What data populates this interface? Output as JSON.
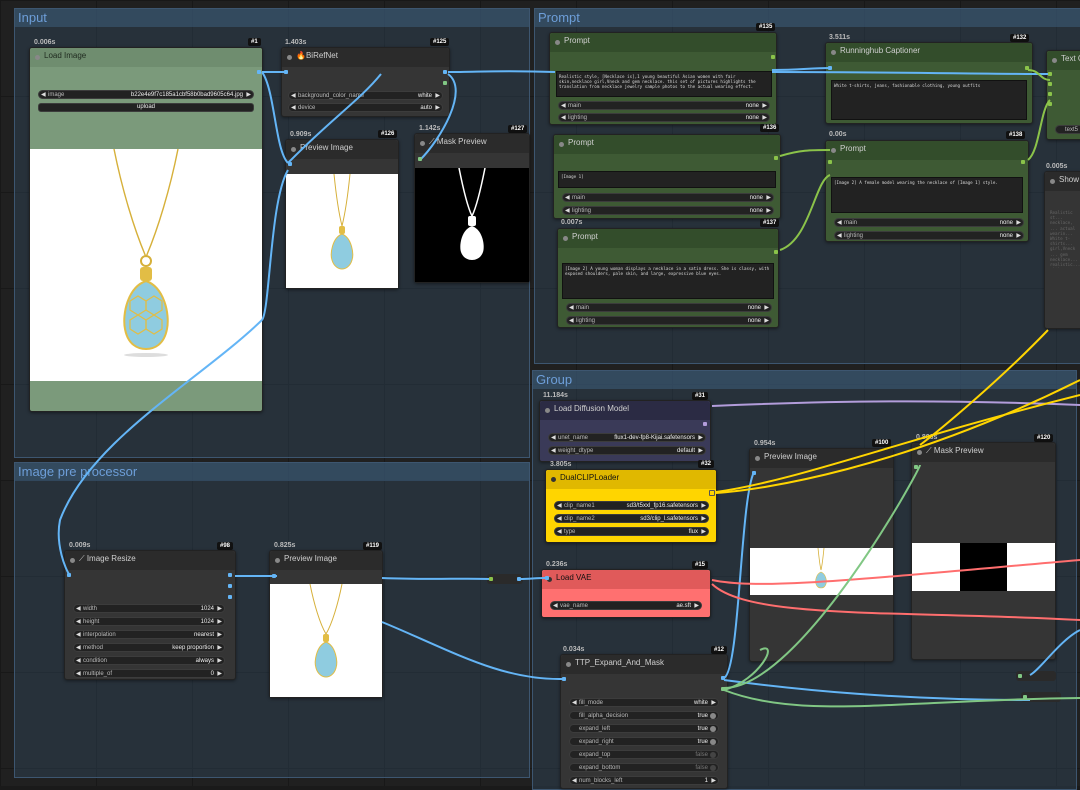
{
  "groups": {
    "input": "Input",
    "prompt": "Prompt",
    "preproc": "Image pre processor",
    "group": "Group"
  },
  "nodes": {
    "load_image": {
      "time": "0.006s",
      "badge": "#1",
      "title": "Load Image",
      "image_label": "image",
      "image_value": "b22e4e9f7c185a1cbf58b0bad9605c64.jpg",
      "upload": "upload"
    },
    "birefnet": {
      "time": "1.403s",
      "badge": "#125",
      "title": "🔥BiRefNet",
      "bg_label": "background_color_name",
      "bg_value": "white",
      "device_label": "device",
      "device_value": "auto"
    },
    "preview126": {
      "time": "0.909s",
      "badge": "#126",
      "title": "Preview Image"
    },
    "mask127": {
      "time": "1.142s",
      "badge": "#127",
      "title": "Mask Preview"
    },
    "prompt135": {
      "badge": "#135",
      "title": "Prompt",
      "text": "Realistic style, [Necklace is],1 young beautiful Asian women with fair skin,necklace girl,Vneck and gem necklace. this set of pictures highlights the translation from necklace jewelry sample photos to the actual wearing effect.",
      "main_label": "main",
      "main_value": "none",
      "lighting_label": "lighting",
      "lighting_value": "none"
    },
    "prompt136": {
      "badge": "#136",
      "title": "Prompt",
      "text": "[Image 1]",
      "main_label": "main",
      "main_value": "none",
      "lighting_label": "lighting",
      "lighting_value": "none"
    },
    "prompt137": {
      "time": "0.007s",
      "badge": "#137",
      "title": "Prompt",
      "text": "[Image 2] A young woman displays a necklace in a satin dress. She is classy, with exposed shoulders, pale skin, and large, expressive blue eyes.",
      "main_label": "main",
      "main_value": "none",
      "lighting_label": "lighting",
      "lighting_value": "none"
    },
    "captioner": {
      "time": "3.511s",
      "badge": "#132",
      "title": "Runninghub Captioner",
      "text": "White t-shirts, jeans, fashionable clothing, young outfits"
    },
    "prompt138": {
      "time": "0.00s",
      "badge": "#138",
      "title": "Prompt",
      "text": "[Image 2] A female model wearing the necklace of [Image 1] style.",
      "main_label": "main",
      "main_value": "none",
      "lighting_label": "lighting",
      "lighting_value": "none"
    },
    "textnode": {
      "title": "Text C",
      "widget": "text5"
    },
    "show": {
      "time": "0.005s",
      "title": "Show T",
      "text": "Realistic st... necklace, ... actual wearin... White t-shirts... girl,Vneck ... gem necklace... realistic... with exposed... necklace of..."
    },
    "diffusion": {
      "time": "11.184s",
      "badge": "#31",
      "title": "Load Diffusion Model",
      "unet_label": "unet_name",
      "unet_value": "flux1-dev-fp8-Kijai.safetensors",
      "dtype_label": "weight_dtype",
      "dtype_value": "default"
    },
    "dualclip": {
      "time": "3.805s",
      "badge": "#32",
      "title": "DualCLIPLoader",
      "c1_label": "clip_name1",
      "c1_value": "sd3/t5xxl_fp16.safetensors",
      "c2_label": "clip_name2",
      "c2_value": "sd3/clip_l.safetensors",
      "type_label": "type",
      "type_value": "flux"
    },
    "vae": {
      "time": "0.236s",
      "badge": "#15",
      "title": "Load VAE",
      "vae_label": "vae_name",
      "vae_value": "ae.sft"
    },
    "preview100": {
      "time": "0.954s",
      "badge": "#100",
      "title": "Preview Image"
    },
    "mask120": {
      "time": "0.806s",
      "badge": "#120",
      "title": "Mask Preview"
    },
    "resize": {
      "time": "0.009s",
      "badge": "#98",
      "title": "Image Resize",
      "widgets": [
        {
          "label": "width",
          "value": "1024"
        },
        {
          "label": "height",
          "value": "1024"
        },
        {
          "label": "interpolation",
          "value": "nearest"
        },
        {
          "label": "method",
          "value": "keep proportion"
        },
        {
          "label": "condition",
          "value": "always"
        },
        {
          "label": "multiple_of",
          "value": "0"
        }
      ]
    },
    "preview119": {
      "time": "0.825s",
      "badge": "#119",
      "title": "Preview Image"
    },
    "expand": {
      "time": "0.034s",
      "badge": "#12",
      "title": "TTP_Expand_And_Mask",
      "widgets": [
        {
          "label": "fill_mode",
          "value": "white",
          "kind": "combo"
        },
        {
          "label": "fill_alpha_decision",
          "value": "true",
          "kind": "toggle"
        },
        {
          "label": "expand_left",
          "value": "true",
          "kind": "toggle"
        },
        {
          "label": "expand_right",
          "value": "true",
          "kind": "toggle"
        },
        {
          "label": "expand_top",
          "value": "false",
          "kind": "toggle"
        },
        {
          "label": "expand_bottom",
          "value": "false",
          "kind": "toggle"
        },
        {
          "label": "num_blocks_left",
          "value": "1",
          "kind": "combo"
        }
      ]
    }
  },
  "colors": {
    "image_link": "#64b5f6",
    "conditioning": "#ffd500",
    "model": "#b39ddb",
    "vae": "#ff6e6e",
    "mask": "#81c784",
    "string": "#8bc34a",
    "prompt_node": "#334d2b",
    "dualclip_node": "#ffd500",
    "vae_node": "#ff7070",
    "diffusion_node": "#2b2b44"
  }
}
